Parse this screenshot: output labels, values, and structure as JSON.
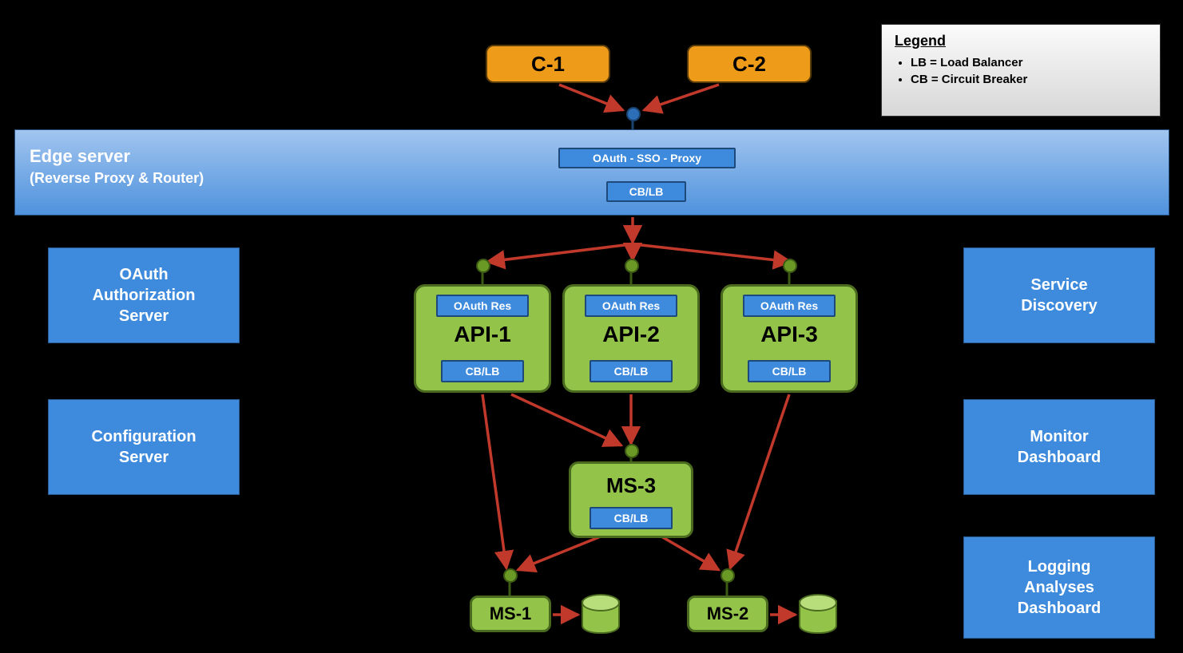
{
  "legend": {
    "title": "Legend",
    "items": [
      "LB = Load Balancer",
      "CB = Circuit Breaker"
    ]
  },
  "clients": {
    "c1": "C-1",
    "c2": "C-2"
  },
  "edge": {
    "title": "Edge server",
    "subtitle": "(Reverse Proxy & Router)",
    "oauth_sso_proxy": "OAuth - SSO - Proxy",
    "cblb": "CB/LB"
  },
  "left_boxes": {
    "oauth_server": "OAuth\nAuthorization\nServer",
    "config_server": "Configuration\nServer"
  },
  "right_boxes": {
    "discovery": "Service\nDiscovery",
    "monitor": "Monitor\nDashboard",
    "logging": "Logging\nAnalyses\nDashboard"
  },
  "api": {
    "oauth_res": "OAuth Res",
    "cblb": "CB/LB",
    "a1": "API-1",
    "a2": "API-2",
    "a3": "API-3"
  },
  "ms": {
    "ms3": "MS-3",
    "ms3_cblb": "CB/LB",
    "ms1": "MS-1",
    "ms2": "MS-2"
  }
}
